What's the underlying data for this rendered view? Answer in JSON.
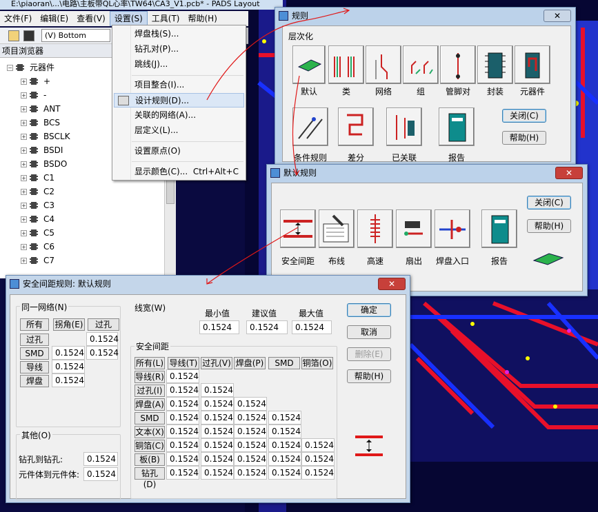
{
  "window_title": "E:\\piaoran\\...\\电路\\主板带QL心率\\TW64\\CA3_V1.pcb* - PADS Layout",
  "menubar": [
    "文件(F)",
    "编辑(E)",
    "查看(V)",
    "设置(S)",
    "工具(T)",
    "帮助(H)"
  ],
  "toolbar": {
    "layer": "(V) Bottom"
  },
  "project_browser": {
    "title": "项目浏览器",
    "root": "元器件",
    "items": [
      "+",
      "-",
      "ANT",
      "BCS",
      "BSCLK",
      "BSDI",
      "BSDO",
      "C1",
      "C2",
      "C3",
      "C4",
      "C5",
      "C6",
      "C7"
    ]
  },
  "setup_menu": {
    "items": [
      "焊盘栈(S)...",
      "钻孔对(P)...",
      "跳线(J)...",
      "项目整合(I)...",
      "设计规则(D)...",
      "关联的网络(A)...",
      "层定义(L)...",
      "设置原点(O)",
      "显示颜色(C)..."
    ],
    "shortcut": "Ctrl+Alt+C"
  },
  "rules_dialog": {
    "title": "规则",
    "close_x": "✕",
    "section": "层次化",
    "icons": [
      "默认",
      "类",
      "网络",
      "组",
      "管脚对",
      "封装",
      "元器件",
      "条件规则",
      "差分",
      "已关联",
      "报告"
    ],
    "close": "关闭(C)",
    "help": "帮助(H)"
  },
  "default_rules_dialog": {
    "title": "默认规则",
    "close_x": "✕",
    "icons": [
      "安全间距",
      "布线",
      "高速",
      "扇出",
      "焊盘入口",
      "报告"
    ],
    "close": "关闭(C)",
    "help": "帮助(H)"
  },
  "clearance_dialog": {
    "title": "安全间距规则: 默认规则",
    "close_x": "✕",
    "same_net": {
      "label": "同一网络(N)",
      "buttons": [
        "所有",
        "拐角(E)",
        "过孔"
      ],
      "rows": [
        {
          "label": "过孔",
          "values": [
            "",
            "0.1524"
          ]
        },
        {
          "label": "SMD",
          "values": [
            "0.1524",
            "0.1524"
          ]
        },
        {
          "label": "导线",
          "values": [
            "0.1524"
          ]
        },
        {
          "label": "焊盘",
          "values": [
            "0.1524"
          ]
        }
      ]
    },
    "trace_width": {
      "label": "线宽(W)",
      "headers": [
        "最小值",
        "建议值",
        "最大值"
      ],
      "values": [
        "0.1524",
        "0.1524",
        "0.1524"
      ]
    },
    "clearance": {
      "label": "安全间距",
      "headers": [
        "所有(L)",
        "导线(T)",
        "过孔(V)",
        "焊盘(P)",
        "SMD",
        "铜箔(O)"
      ],
      "rows": [
        {
          "label": "导线(R)",
          "values": [
            "0.1524"
          ]
        },
        {
          "label": "过孔(I)",
          "values": [
            "0.1524",
            "0.1524"
          ]
        },
        {
          "label": "焊盘(A)",
          "values": [
            "0.1524",
            "0.1524",
            "0.1524"
          ]
        },
        {
          "label": "SMD",
          "values": [
            "0.1524",
            "0.1524",
            "0.1524",
            "0.1524"
          ]
        },
        {
          "label": "文本(X)",
          "values": [
            "0.1524",
            "0.1524",
            "0.1524",
            "0.1524"
          ]
        },
        {
          "label": "铜箔(C)",
          "values": [
            "0.1524",
            "0.1524",
            "0.1524",
            "0.1524",
            "0.1524"
          ]
        },
        {
          "label": "板(B)",
          "values": [
            "0.1524",
            "0.1524",
            "0.1524",
            "0.1524",
            "0.1524"
          ]
        },
        {
          "label": "钻孔(D)",
          "values": [
            "0.1524",
            "0.1524",
            "0.1524",
            "0.1524",
            "0.1524"
          ]
        }
      ]
    },
    "other": {
      "label": "其他(O)",
      "drill_to_drill_label": "钻孔到钻孔:",
      "drill_to_drill": "0.1524",
      "body_to_body_label": "元件体到元件体:",
      "body_to_body": "0.1524"
    },
    "buttons": {
      "ok": "确定",
      "cancel": "取消",
      "delete": "删除(E)",
      "help": "帮助(H)"
    }
  },
  "colors": {
    "pcb_bg": "#060633",
    "trace_red": "#e8102a",
    "trace_blue": "#1830ff",
    "annotation": "#e01818"
  }
}
